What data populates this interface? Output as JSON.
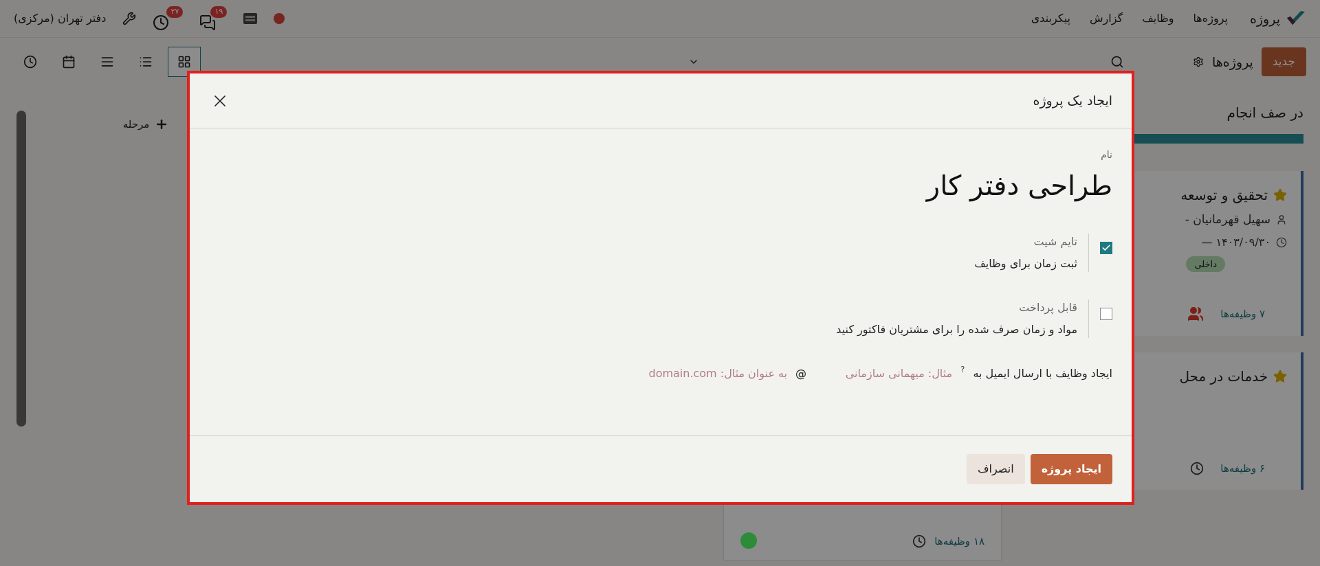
{
  "navbar": {
    "app_name": "پروژه",
    "menu": [
      "پروژه‌ها",
      "وظایف",
      "گزارش",
      "پیکربندی"
    ],
    "company": "دفتر تهران (مرکزی)",
    "activity_count": "۲۷",
    "message_count": "۱۹"
  },
  "control_panel": {
    "new_button": "جدید",
    "breadcrumb": "پروژه‌ها",
    "views": [
      {
        "kind": "kanban",
        "selected": true
      },
      {
        "kind": "list",
        "selected": false
      },
      {
        "kind": "gantt",
        "selected": false
      },
      {
        "kind": "calendar",
        "selected": false
      },
      {
        "kind": "activity",
        "selected": false
      }
    ]
  },
  "kanban": {
    "columns": [
      {
        "title": "در صف انجام",
        "level": 0.6,
        "cards": [
          {
            "kind": "full",
            "favorite": true,
            "name": "تحقیق و توسعه",
            "manager": "سهیل قهرمانیان -",
            "date": "۱۴۰۳/۰۹/۳۰ —",
            "tag": "داخلی",
            "task_count": "۷ وظیفه‌ها"
          },
          {
            "kind": "short",
            "favorite": true,
            "name": "خدمات در محل",
            "task_count": "۶ وظیفه‌ها"
          }
        ]
      },
      {
        "cards": [
          {
            "kind": "footer",
            "task_count": "۱۸ وظیفه‌ها",
            "color": "#2e8b3a"
          }
        ]
      }
    ],
    "add_stage": "مرحله"
  },
  "dialog": {
    "title": "ایجاد یک پروژه",
    "name_label": "نام",
    "name_value": "طراحی دفتر کار",
    "options": [
      {
        "label": "تایم شیت",
        "description": "ثبت زمان برای وظایف",
        "checked": true
      },
      {
        "label": "قابل پرداخت",
        "description": "مواد و زمان صرف شده را برای مشتریان فاکتور کنید",
        "checked": false
      }
    ],
    "alias": {
      "label": "ایجاد وظایف با ارسال ایمیل به",
      "help": "?",
      "alias_placeholder": "مثال: میهمانی سازمانی",
      "at": "@",
      "domain_placeholder": "به عنوان مثال: domain.com"
    },
    "buttons": {
      "primary": "ایجاد پروژه",
      "secondary": "انصراف"
    }
  }
}
